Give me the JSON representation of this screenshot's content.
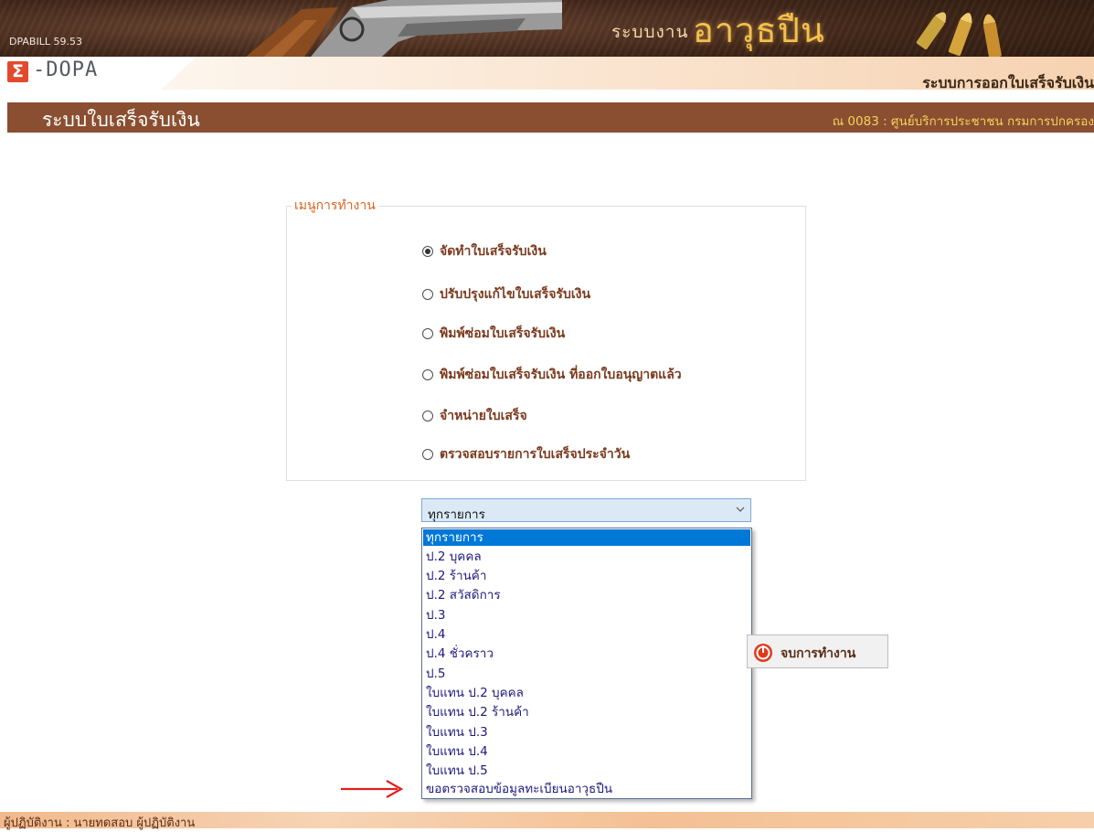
{
  "header": {
    "version": "DPABILL 59.53",
    "app_title_small": "ระบบงาน",
    "app_title_big": "อาวุธปืน",
    "logo_mark": "Σ",
    "logo_text": "-DOPA",
    "system_name": "ระบบการออกใบเสร็จรับเงิน"
  },
  "titlebar": {
    "page_title": "ระบบใบเสร็จรับเงิน",
    "office": "ณ 0083 : ศูนย์บริการประชาชน กรมการปกครอง"
  },
  "menu": {
    "legend": "เมนูการทำงาน",
    "options": [
      {
        "label": "จัดทำใบเสร็จรับเงิน",
        "checked": true
      },
      {
        "label": "ปรับปรุงแก้ไขใบเสร็จรับเงิน",
        "checked": false
      },
      {
        "label": "พิมพ์ซ่อมใบเสร็จรับเงิน",
        "checked": false
      },
      {
        "label": "พิมพ์ซ่อมใบเสร็จรับเงิน ที่ออกใบอนุญาตแล้ว",
        "checked": false
      },
      {
        "label": "จำหน่ายใบเสร็จ",
        "checked": false
      },
      {
        "label": "ตรวจสอบรายการใบเสร็จประจำวัน",
        "checked": false
      }
    ]
  },
  "receipt_type": {
    "selected": "ทุกรายการ",
    "options": [
      "ทุกรายการ",
      "ป.2 บุคคล",
      "ป.2 ร้านค้า",
      "ป.2 สวัสดิการ",
      "ป.3",
      "ป.4",
      "ป.4 ชั่วคราว",
      "ป.5",
      "ใบแทน ป.2 บุคคล",
      "ใบแทน ป.2 ร้านค้า",
      "ใบแทน ป.3",
      "ใบแทน ป.4",
      "ใบแทน ป.5",
      "ขอตรวจสอบข้อมูลทะเบียนอาวุธปืน"
    ]
  },
  "buttons": {
    "exit_label": "จบการทำงาน"
  },
  "footer": {
    "operator": "ผู้ปฏิบัติงาน :   นายทดสอบ ผู้ปฏิบัติงาน"
  },
  "colors": {
    "titlebar": "#8a4f30",
    "accent_orange": "#d9641c",
    "selected_item": "#0078d7",
    "annotation_arrow": "#e02020"
  }
}
